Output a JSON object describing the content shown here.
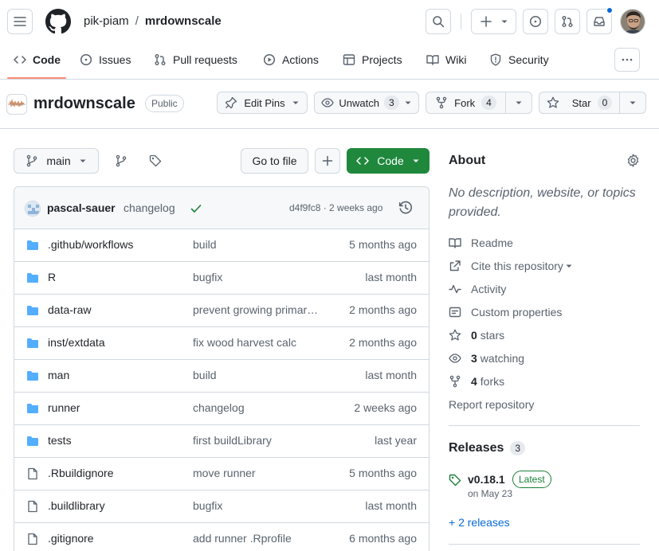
{
  "header": {
    "owner": "pik-piam",
    "separator": "/",
    "repo": "mrdownscale"
  },
  "nav": {
    "tabs": [
      {
        "label": "Code",
        "icon": "code-icon",
        "selected": true
      },
      {
        "label": "Issues",
        "icon": "issue-icon"
      },
      {
        "label": "Pull requests",
        "icon": "pull-request-icon"
      },
      {
        "label": "Actions",
        "icon": "play-icon"
      },
      {
        "label": "Projects",
        "icon": "table-icon"
      },
      {
        "label": "Wiki",
        "icon": "book-icon"
      },
      {
        "label": "Security",
        "icon": "shield-icon"
      }
    ]
  },
  "repo_header": {
    "name": "mrdownscale",
    "visibility": "Public",
    "edit_pins": "Edit Pins",
    "unwatch": "Unwatch",
    "watch_count": "3",
    "fork": "Fork",
    "fork_count": "4",
    "star": "Star",
    "star_count": "0"
  },
  "toolbar": {
    "branch": "main",
    "go_to_file": "Go to file",
    "code": "Code"
  },
  "commit": {
    "author": "pascal-sauer",
    "message": "changelog",
    "hash_time": "d4f9fc8 · 2 weeks ago"
  },
  "files": [
    {
      "type": "dir",
      "name": ".github/workflows",
      "message": "build",
      "date": "5 months ago"
    },
    {
      "type": "dir",
      "name": "R",
      "message": "bugfix",
      "date": "last month"
    },
    {
      "type": "dir",
      "name": "data-raw",
      "message": "prevent growing primary forest",
      "date": "2 months ago"
    },
    {
      "type": "dir",
      "name": "inst/extdata",
      "message": "fix wood harvest calc",
      "date": "2 months ago"
    },
    {
      "type": "dir",
      "name": "man",
      "message": "build",
      "date": "last month"
    },
    {
      "type": "dir",
      "name": "runner",
      "message": "changelog",
      "date": "2 weeks ago"
    },
    {
      "type": "dir",
      "name": "tests",
      "message": "first buildLibrary",
      "date": "last year"
    },
    {
      "type": "file",
      "name": ".Rbuildignore",
      "message": "move runner",
      "date": "5 months ago"
    },
    {
      "type": "file",
      "name": ".buildlibrary",
      "message": "bugfix",
      "date": "last month"
    },
    {
      "type": "file",
      "name": ".gitignore",
      "message": "add runner .Rprofile",
      "date": "6 months ago"
    }
  ],
  "about": {
    "title": "About",
    "description": "No description, website, or topics provided.",
    "readme": "Readme",
    "cite": "Cite this repository",
    "activity": "Activity",
    "custom_properties": "Custom properties",
    "stars_count": "0",
    "stars_label": "stars",
    "watching_count": "3",
    "watching_label": "watching",
    "forks_count": "4",
    "forks_label": "forks",
    "report": "Report repository"
  },
  "releases": {
    "title": "Releases",
    "count": "3",
    "version": "v0.18.1",
    "latest_badge": "Latest",
    "date": "on May 23",
    "more": "+ 2 releases"
  },
  "colors": {
    "green": "#1f883d",
    "folder": "#54aeff",
    "accent": "#fd8c73",
    "link": "#0969da"
  }
}
